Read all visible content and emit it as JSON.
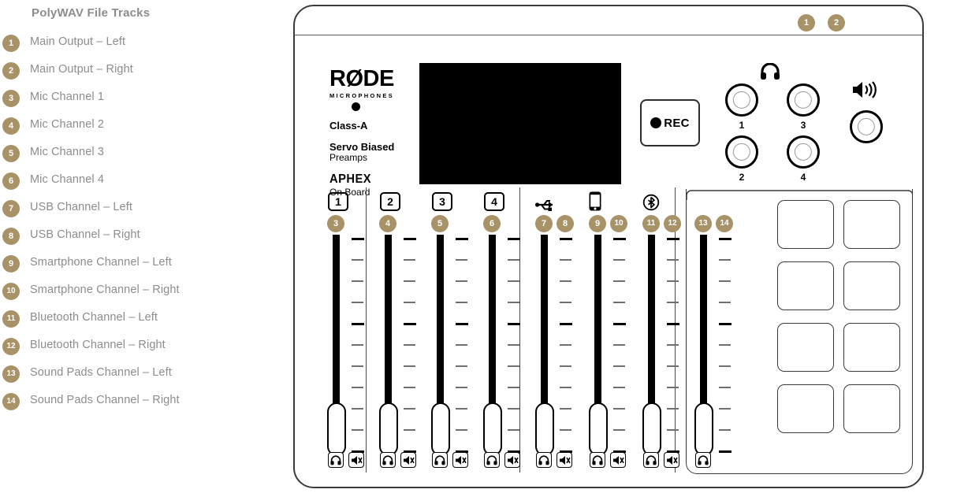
{
  "legend": {
    "title": "PolyWAV File Tracks",
    "items": [
      {
        "num": "1",
        "label": "Main Output – Left"
      },
      {
        "num": "2",
        "label": "Main Output – Right"
      },
      {
        "num": "3",
        "label": "Mic Channel 1"
      },
      {
        "num": "4",
        "label": "Mic Channel 2"
      },
      {
        "num": "5",
        "label": "Mic Channel 3"
      },
      {
        "num": "6",
        "label": "Mic Channel 4"
      },
      {
        "num": "7",
        "label": "USB Channel – Left"
      },
      {
        "num": "8",
        "label": "USB Channel – Right"
      },
      {
        "num": "9",
        "label": "Smartphone Channel – Left"
      },
      {
        "num": "10",
        "label": "Smartphone Channel – Right"
      },
      {
        "num": "11",
        "label": "Bluetooth Channel – Left"
      },
      {
        "num": "12",
        "label": "Bluetooth Channel – Right"
      },
      {
        "num": "13",
        "label": "Sound Pads Channel – Left"
      },
      {
        "num": "14",
        "label": "Sound Pads Channel – Right"
      }
    ]
  },
  "device": {
    "top_badges": [
      "1",
      "2"
    ],
    "brand": {
      "name": "RØDE",
      "subtitle": "MICROPHONES",
      "line1": "Class-A",
      "line2": "Servo Biased",
      "line3": "Preamps",
      "aphex": "APHEX",
      "aphex_sub": "On Board"
    },
    "rec_button": {
      "label": "REC"
    },
    "headphone_icon": "headphone-icon",
    "speaker_icon": "speaker-icon",
    "knobs": [
      {
        "label": "1"
      },
      {
        "label": "2"
      },
      {
        "label": "3"
      },
      {
        "label": "4"
      }
    ],
    "monitor_knob": {
      "label": ""
    },
    "channels": [
      {
        "kind": "number",
        "box": "1",
        "badges": [
          "3"
        ]
      },
      {
        "kind": "number",
        "box": "2",
        "badges": [
          "4"
        ]
      },
      {
        "kind": "number",
        "box": "3",
        "badges": [
          "5"
        ]
      },
      {
        "kind": "number",
        "box": "4",
        "badges": [
          "6"
        ]
      },
      {
        "kind": "icon",
        "icon": "usb-icon",
        "badges": [
          "7",
          "8"
        ]
      },
      {
        "kind": "icon",
        "icon": "smartphone-icon",
        "badges": [
          "9",
          "10"
        ]
      },
      {
        "kind": "icon",
        "icon": "bluetooth-icon",
        "badges": [
          "11",
          "12"
        ]
      },
      {
        "kind": "pads",
        "icon": "",
        "badges": [
          "13",
          "14"
        ]
      }
    ],
    "channel_buttons": {
      "solo": "solo-icon",
      "mute": "mute-icon"
    },
    "pad_count": 8
  },
  "colors": {
    "badge_gold": "#a89268",
    "legend_text": "#8d8d8d",
    "outline": "#3a3a3a",
    "screen": "#000000"
  }
}
